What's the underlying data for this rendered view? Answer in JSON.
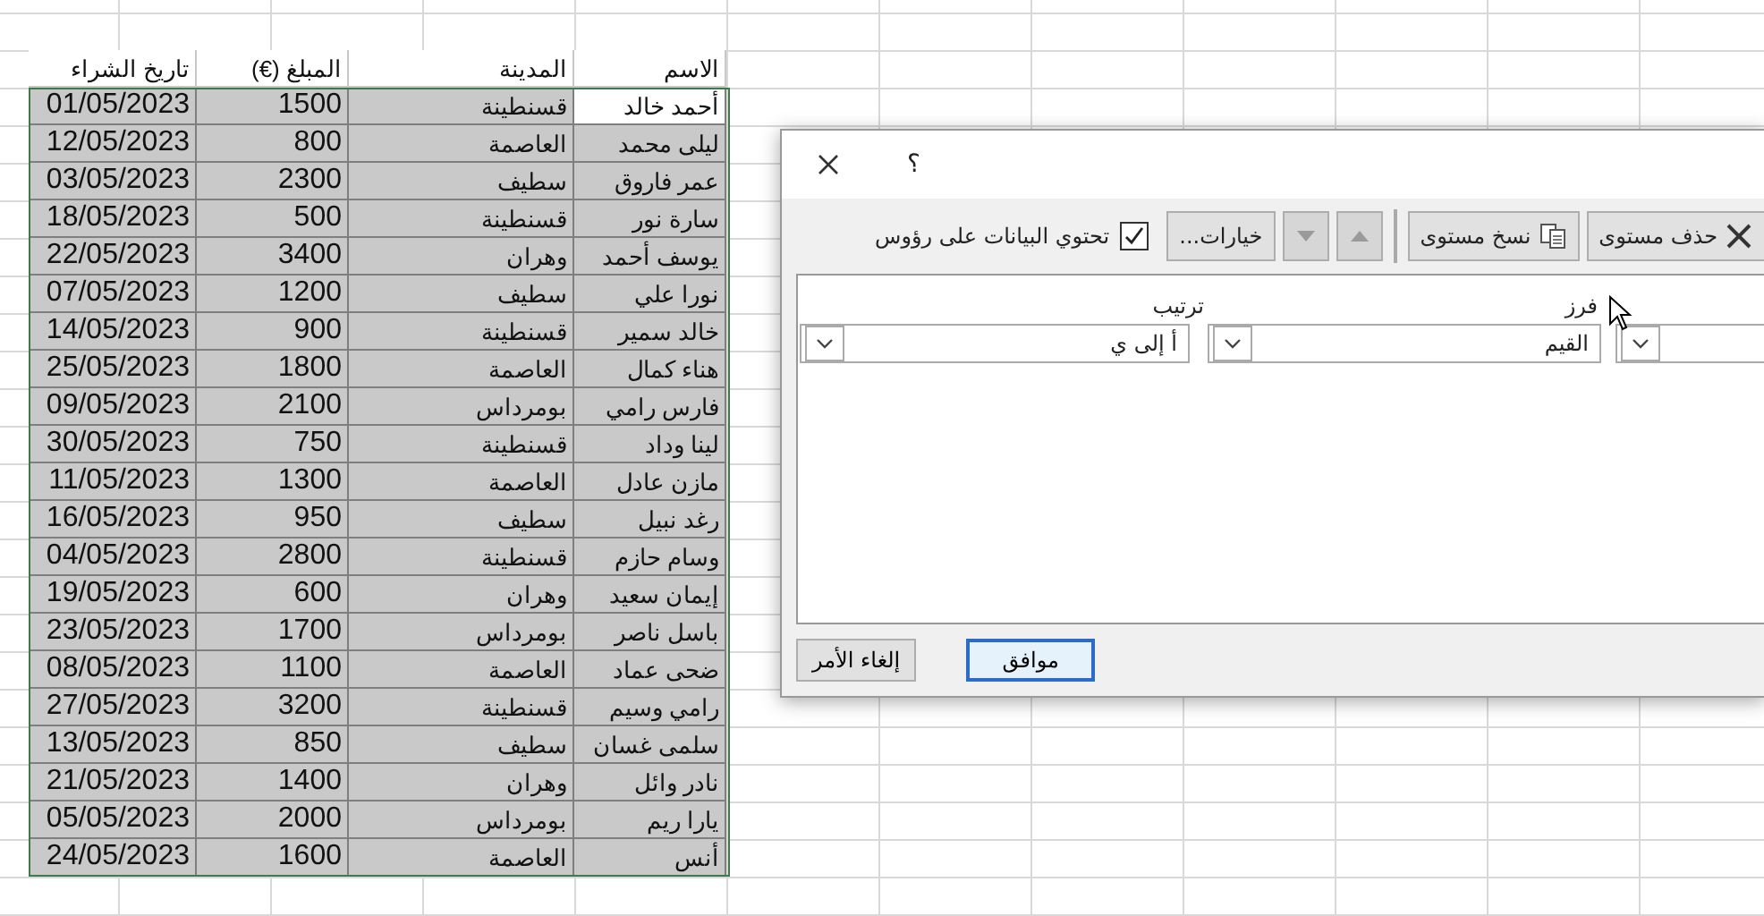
{
  "sheet": {
    "columns": [
      "الاسم",
      "المدينة",
      "المبلغ (€)",
      "تاريخ الشراء"
    ],
    "rows": [
      {
        "date": "01/05/2023",
        "amount": "1500",
        "city": "قسنطينة",
        "name": "أحمد خالد",
        "active": true
      },
      {
        "date": "12/05/2023",
        "amount": "800",
        "city": "العاصمة",
        "name": "ليلى محمد",
        "active": false
      },
      {
        "date": "03/05/2023",
        "amount": "2300",
        "city": "سطيف",
        "name": "عمر فاروق",
        "active": false
      },
      {
        "date": "18/05/2023",
        "amount": "500",
        "city": "قسنطينة",
        "name": "سارة نور",
        "active": false
      },
      {
        "date": "22/05/2023",
        "amount": "3400",
        "city": "وهران",
        "name": "يوسف أحمد",
        "active": false
      },
      {
        "date": "07/05/2023",
        "amount": "1200",
        "city": "سطيف",
        "name": "نورا علي",
        "active": false
      },
      {
        "date": "14/05/2023",
        "amount": "900",
        "city": "قسنطينة",
        "name": "خالد سمير",
        "active": false
      },
      {
        "date": "25/05/2023",
        "amount": "1800",
        "city": "العاصمة",
        "name": "هناء كمال",
        "active": false
      },
      {
        "date": "09/05/2023",
        "amount": "2100",
        "city": "بومرداس",
        "name": "فارس رامي",
        "active": false
      },
      {
        "date": "30/05/2023",
        "amount": "750",
        "city": "قسنطينة",
        "name": "لينا وداد",
        "active": false
      },
      {
        "date": "11/05/2023",
        "amount": "1300",
        "city": "العاصمة",
        "name": "مازن عادل",
        "active": false
      },
      {
        "date": "16/05/2023",
        "amount": "950",
        "city": "سطيف",
        "name": "رغد نبيل",
        "active": false
      },
      {
        "date": "04/05/2023",
        "amount": "2800",
        "city": "قسنطينة",
        "name": "وسام حازم",
        "active": false
      },
      {
        "date": "19/05/2023",
        "amount": "600",
        "city": "وهران",
        "name": "إيمان سعيد",
        "active": false
      },
      {
        "date": "23/05/2023",
        "amount": "1700",
        "city": "بومرداس",
        "name": "باسل ناصر",
        "active": false
      },
      {
        "date": "08/05/2023",
        "amount": "1100",
        "city": "العاصمة",
        "name": "ضحى عماد",
        "active": false
      },
      {
        "date": "27/05/2023",
        "amount": "3200",
        "city": "قسنطينة",
        "name": "رامي وسيم",
        "active": false
      },
      {
        "date": "13/05/2023",
        "amount": "850",
        "city": "سطيف",
        "name": "سلمى غسان",
        "active": false
      },
      {
        "date": "21/05/2023",
        "amount": "1400",
        "city": "وهران",
        "name": "نادر وائل",
        "active": false
      },
      {
        "date": "05/05/2023",
        "amount": "2000",
        "city": "بومرداس",
        "name": "يارا ريم",
        "active": false
      },
      {
        "date": "24/05/2023",
        "amount": "1600",
        "city": "العاصمة",
        "name": "أنس",
        "active": false
      }
    ]
  },
  "dialog": {
    "help": "؟",
    "toolbar": [
      {
        "kind": "delete",
        "label": "حذف مستوى",
        "disabled": false
      },
      {
        "kind": "copy",
        "label": "نسخ مستوى",
        "disabled": false
      },
      {
        "kind": "up",
        "disabled": true
      },
      {
        "kind": "down",
        "disabled": true
      },
      {
        "kind": "options",
        "label": "خيارات...",
        "disabled": false
      }
    ],
    "headers_checkbox": {
      "label": "تحتوي البيانات على رؤوس",
      "checked": true
    },
    "columns": [
      "فرز",
      "ترتيب"
    ],
    "levels": [
      {
        "sort_on": "القيم",
        "order": "أ إلى ي"
      }
    ],
    "buttons": [
      {
        "kind": "ok",
        "label": "موافق"
      },
      {
        "kind": "cancel",
        "label": "إلغاء الأمر"
      }
    ]
  }
}
